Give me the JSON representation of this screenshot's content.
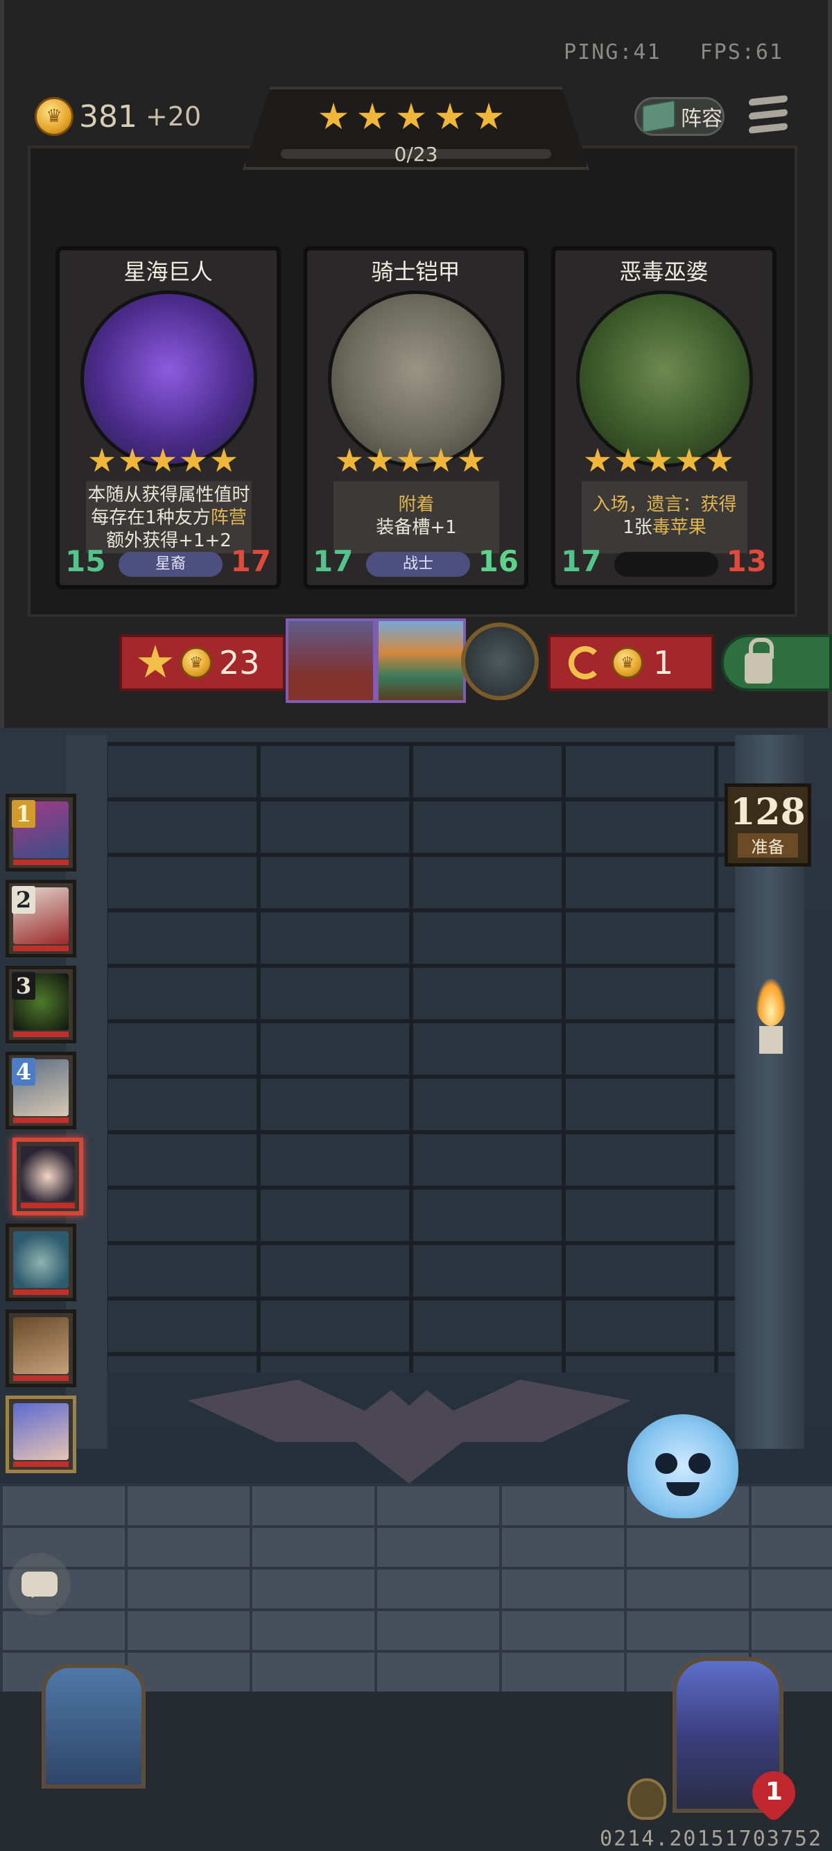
{
  "status": {
    "ping": "PING:41",
    "fps": "FPS:61"
  },
  "gold": {
    "amount": "381",
    "income": "+20"
  },
  "tavern": {
    "progress_text": "0/23",
    "star_count": 5
  },
  "header": {
    "lineup_label": "阵容"
  },
  "cards": [
    {
      "title": "星海巨人",
      "desc_parts": [
        "本随从获得属性值时",
        "每存在1种友方",
        "阵营",
        "额外获得+1+2"
      ],
      "attack": "15",
      "health": "17",
      "tribe": "星裔"
    },
    {
      "title": "骑士铠甲",
      "desc_parts": [
        "附着",
        "装备槽+1"
      ],
      "attack": "17",
      "health": "16",
      "tribe": "战士"
    },
    {
      "title": "恶毒巫婆",
      "desc_parts": [
        "入场，遗言：获得",
        "1张",
        "毒苹果"
      ],
      "attack": "17",
      "health": "13",
      "tribe": ""
    }
  ],
  "actions": {
    "upgrade_cost": "23",
    "refresh_cost": "1"
  },
  "battle": {
    "ready_count": "128",
    "ready_label": "准备",
    "player_health": "1"
  },
  "queue": [
    {
      "rank": "1"
    },
    {
      "rank": "2"
    },
    {
      "rank": "3"
    },
    {
      "rank": "4"
    },
    {
      "rank": ""
    },
    {
      "rank": ""
    },
    {
      "rank": ""
    },
    {
      "rank": ""
    }
  ],
  "build_version": "0214.20151703752",
  "colors": {
    "highlight": "#e3b54f",
    "health_red": "#c22f2a",
    "action_red": "#a3272b",
    "lock_green": "#2d6f3f"
  }
}
